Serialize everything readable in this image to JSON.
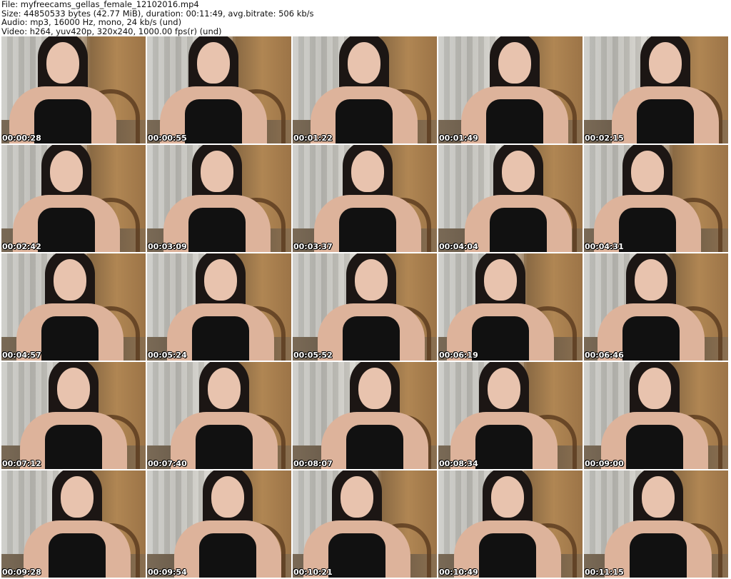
{
  "header": {
    "file": "File: myfreecams_gellas_female_12102016.mp4",
    "size": "Size: 44850533 bytes (42.77 MiB), duration: 00:11:49, avg.bitrate: 506 kb/s",
    "audio": "Audio: mp3, 16000 Hz, mono, 24 kb/s (und)",
    "video": "Video: h264, yuv420p, 320x240, 1000.00 fps(r) (und)"
  },
  "thumbnails": [
    "00:00:28",
    "00:00:55",
    "00:01:22",
    "00:01:49",
    "00:02:15",
    "00:02:42",
    "00:03:09",
    "00:03:37",
    "00:04:04",
    "00:04:31",
    "00:04:57",
    "00:05:24",
    "00:05:52",
    "00:06:19",
    "00:06:46",
    "00:07:12",
    "00:07:40",
    "00:08:07",
    "00:08:34",
    "00:09:00",
    "00:09:28",
    "00:09:54",
    "00:10:21",
    "00:10:49",
    "00:11:15"
  ]
}
